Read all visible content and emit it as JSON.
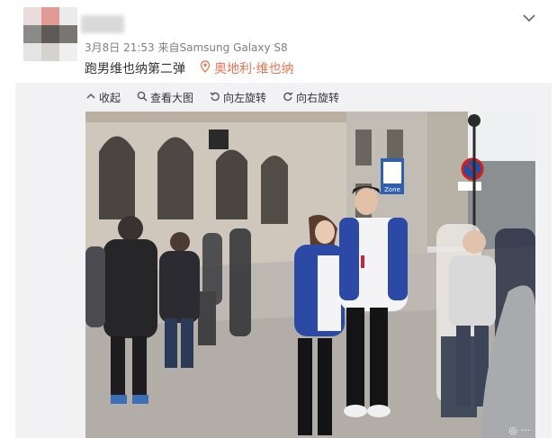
{
  "post": {
    "date_time": "3月8日 21:53",
    "source_prefix": "来自",
    "device": "Samsung Galaxy S8",
    "text": "跑男维也纳第二弹",
    "location": "奥地利·维也纳"
  },
  "toolbar": {
    "collapse_label": "收起",
    "view_large_label": "查看大图",
    "rotate_left_label": "向左旋转",
    "rotate_right_label": "向右旋转"
  },
  "photo": {
    "sign_label": "Zone"
  },
  "colors": {
    "location": "#eb7350",
    "panel_bg": "#f2f2f5",
    "meta_text": "#808080"
  },
  "icons": [
    "chevron-down-icon",
    "location-pin-icon",
    "collapse-icon",
    "search-icon",
    "rotate-left-icon",
    "rotate-right-icon"
  ]
}
